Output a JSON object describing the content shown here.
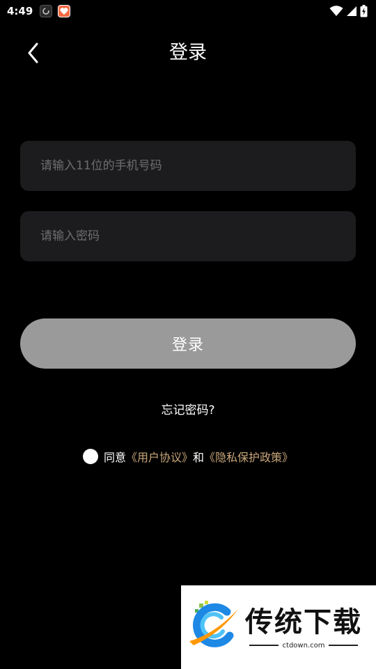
{
  "status_bar": {
    "time": "4:49"
  },
  "header": {
    "title": "登录",
    "back_icon": "chevron-left-icon"
  },
  "form": {
    "phone_placeholder": "请输入11位的手机号码",
    "phone_value": "",
    "password_placeholder": "请输入密码",
    "password_value": "",
    "login_label": "登录",
    "forgot_label": "忘记密码?"
  },
  "agreement": {
    "prefix": "同意",
    "user_agreement": "《用户协议》",
    "and": "和",
    "privacy_policy": "《隐私保护政策》"
  },
  "watermark": {
    "title": "传统下载",
    "subtitle": "ctdown.com"
  },
  "colors": {
    "background": "#000000",
    "input_bg": "#1c1c1e",
    "button_bg": "#9a9a9a",
    "link": "#c9a77a"
  }
}
